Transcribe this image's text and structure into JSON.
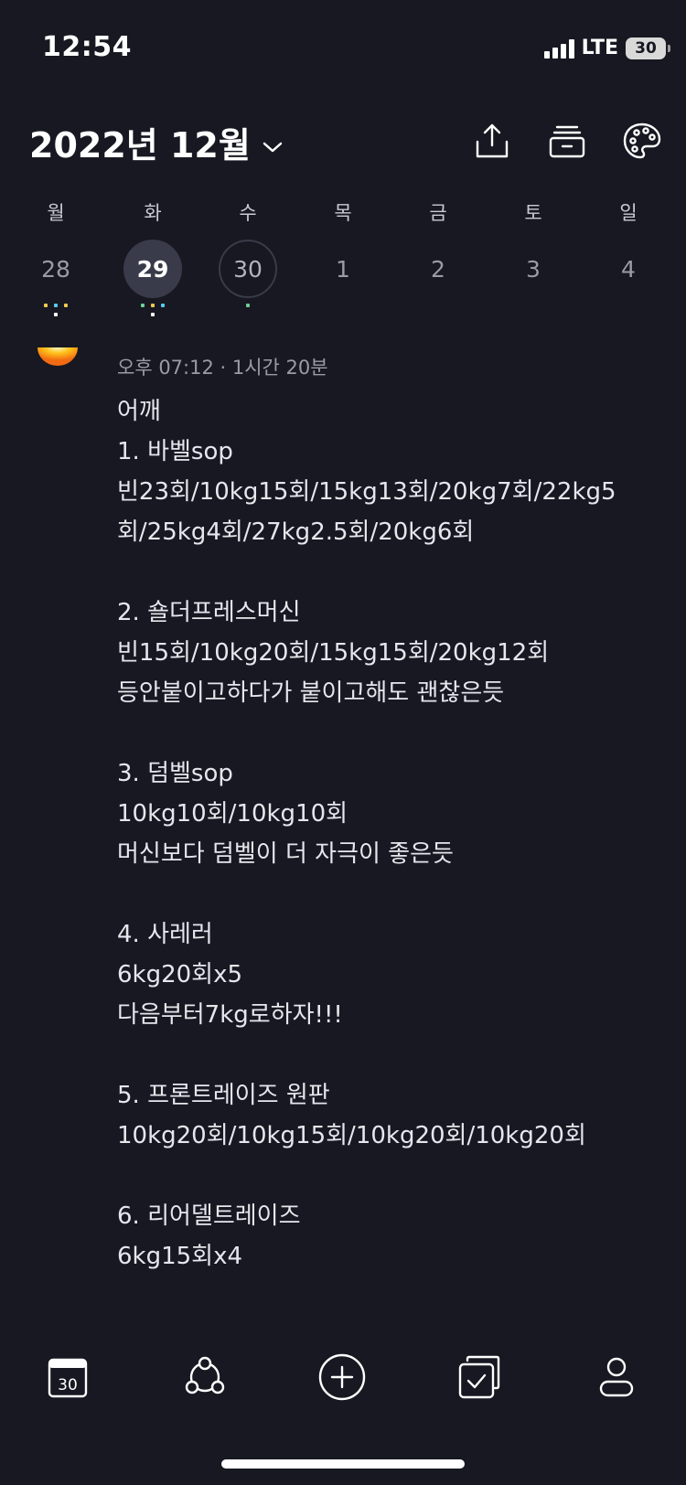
{
  "status_bar": {
    "time": "12:54",
    "network": "LTE",
    "battery": "30"
  },
  "header": {
    "month_label": "2022년 12월",
    "actions": [
      "share-icon",
      "archive-icon",
      "palette-icon"
    ]
  },
  "week": {
    "days": [
      {
        "dow": "월",
        "num": "28"
      },
      {
        "dow": "화",
        "num": "29"
      },
      {
        "dow": "수",
        "num": "30"
      },
      {
        "dow": "목",
        "num": "1"
      },
      {
        "dow": "금",
        "num": "2"
      },
      {
        "dow": "토",
        "num": "3"
      },
      {
        "dow": "일",
        "num": "4"
      }
    ]
  },
  "entry": {
    "meta": "오후 07:12 · 1시간 20분",
    "lines": [
      "어깨",
      "1. 바벨sop",
      "빈23회/10kg15회/15kg13회/20kg7회/22kg5",
      "회/25kg4회/27kg2.5회/20kg6회",
      "2. 숄더프레스머신",
      "빈15회/10kg20회/15kg15회/20kg12회",
      "등안붙이고하다가 붙이고해도 괜찮은듯",
      "3. 덤벨sop",
      "10kg10회/10kg10회",
      "머신보다 덤벨이 더 자극이 좋은듯",
      "4. 사레러",
      "6kg20회x5",
      "다음부터7kg로하자!!!",
      "5. 프론트레이즈 원판",
      "10kg20회/10kg15회/10kg20회/10kg20회",
      "6. 리어델트레이즈",
      "6kg15회x4"
    ]
  },
  "tab_bar": {
    "calendar_badge": "30",
    "tabs": [
      "calendar-tab",
      "community-tab",
      "add-tab",
      "tasks-tab",
      "profile-tab"
    ]
  },
  "colors": {
    "background": "#171821",
    "selected_day": "#3a3b4a",
    "dot_yellow": "#f2c94c",
    "dot_blue": "#56ccf2",
    "dot_green": "#6fcf97"
  }
}
